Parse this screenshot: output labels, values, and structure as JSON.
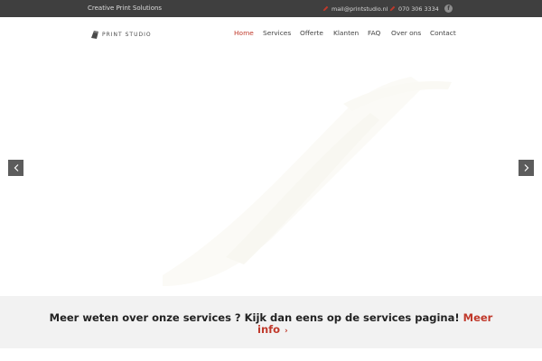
{
  "topbar": {
    "tagline": "Creative Print Solutions",
    "email": "mail@printstudio.nl",
    "phone": "070 306 3334",
    "social_icon": "facebook-icon",
    "facebook_letter": "f"
  },
  "header": {
    "logo_text": "PRINT STUDIO",
    "nav": [
      {
        "label": "Home",
        "active": true
      },
      {
        "label": "Services",
        "active": false
      },
      {
        "label": "Offerte",
        "active": false
      },
      {
        "label": "Klanten",
        "active": false
      },
      {
        "label": "FAQ",
        "active": false
      },
      {
        "label": "Over ons",
        "active": false
      },
      {
        "label": "Contact",
        "active": false
      }
    ]
  },
  "slider": {
    "prev_icon": "chevron-left-icon",
    "next_icon": "chevron-right-icon"
  },
  "cta": {
    "text": "Meer weten over onze services ? Kijk dan eens op de services pagina!",
    "link_word1": "Meer",
    "link_word2": "info",
    "link_icon": "chevron-right-icon"
  },
  "colors": {
    "accent": "#c0392b",
    "topbar_bg": "#3f3f3f",
    "cta_bg": "#f2f2f2"
  }
}
